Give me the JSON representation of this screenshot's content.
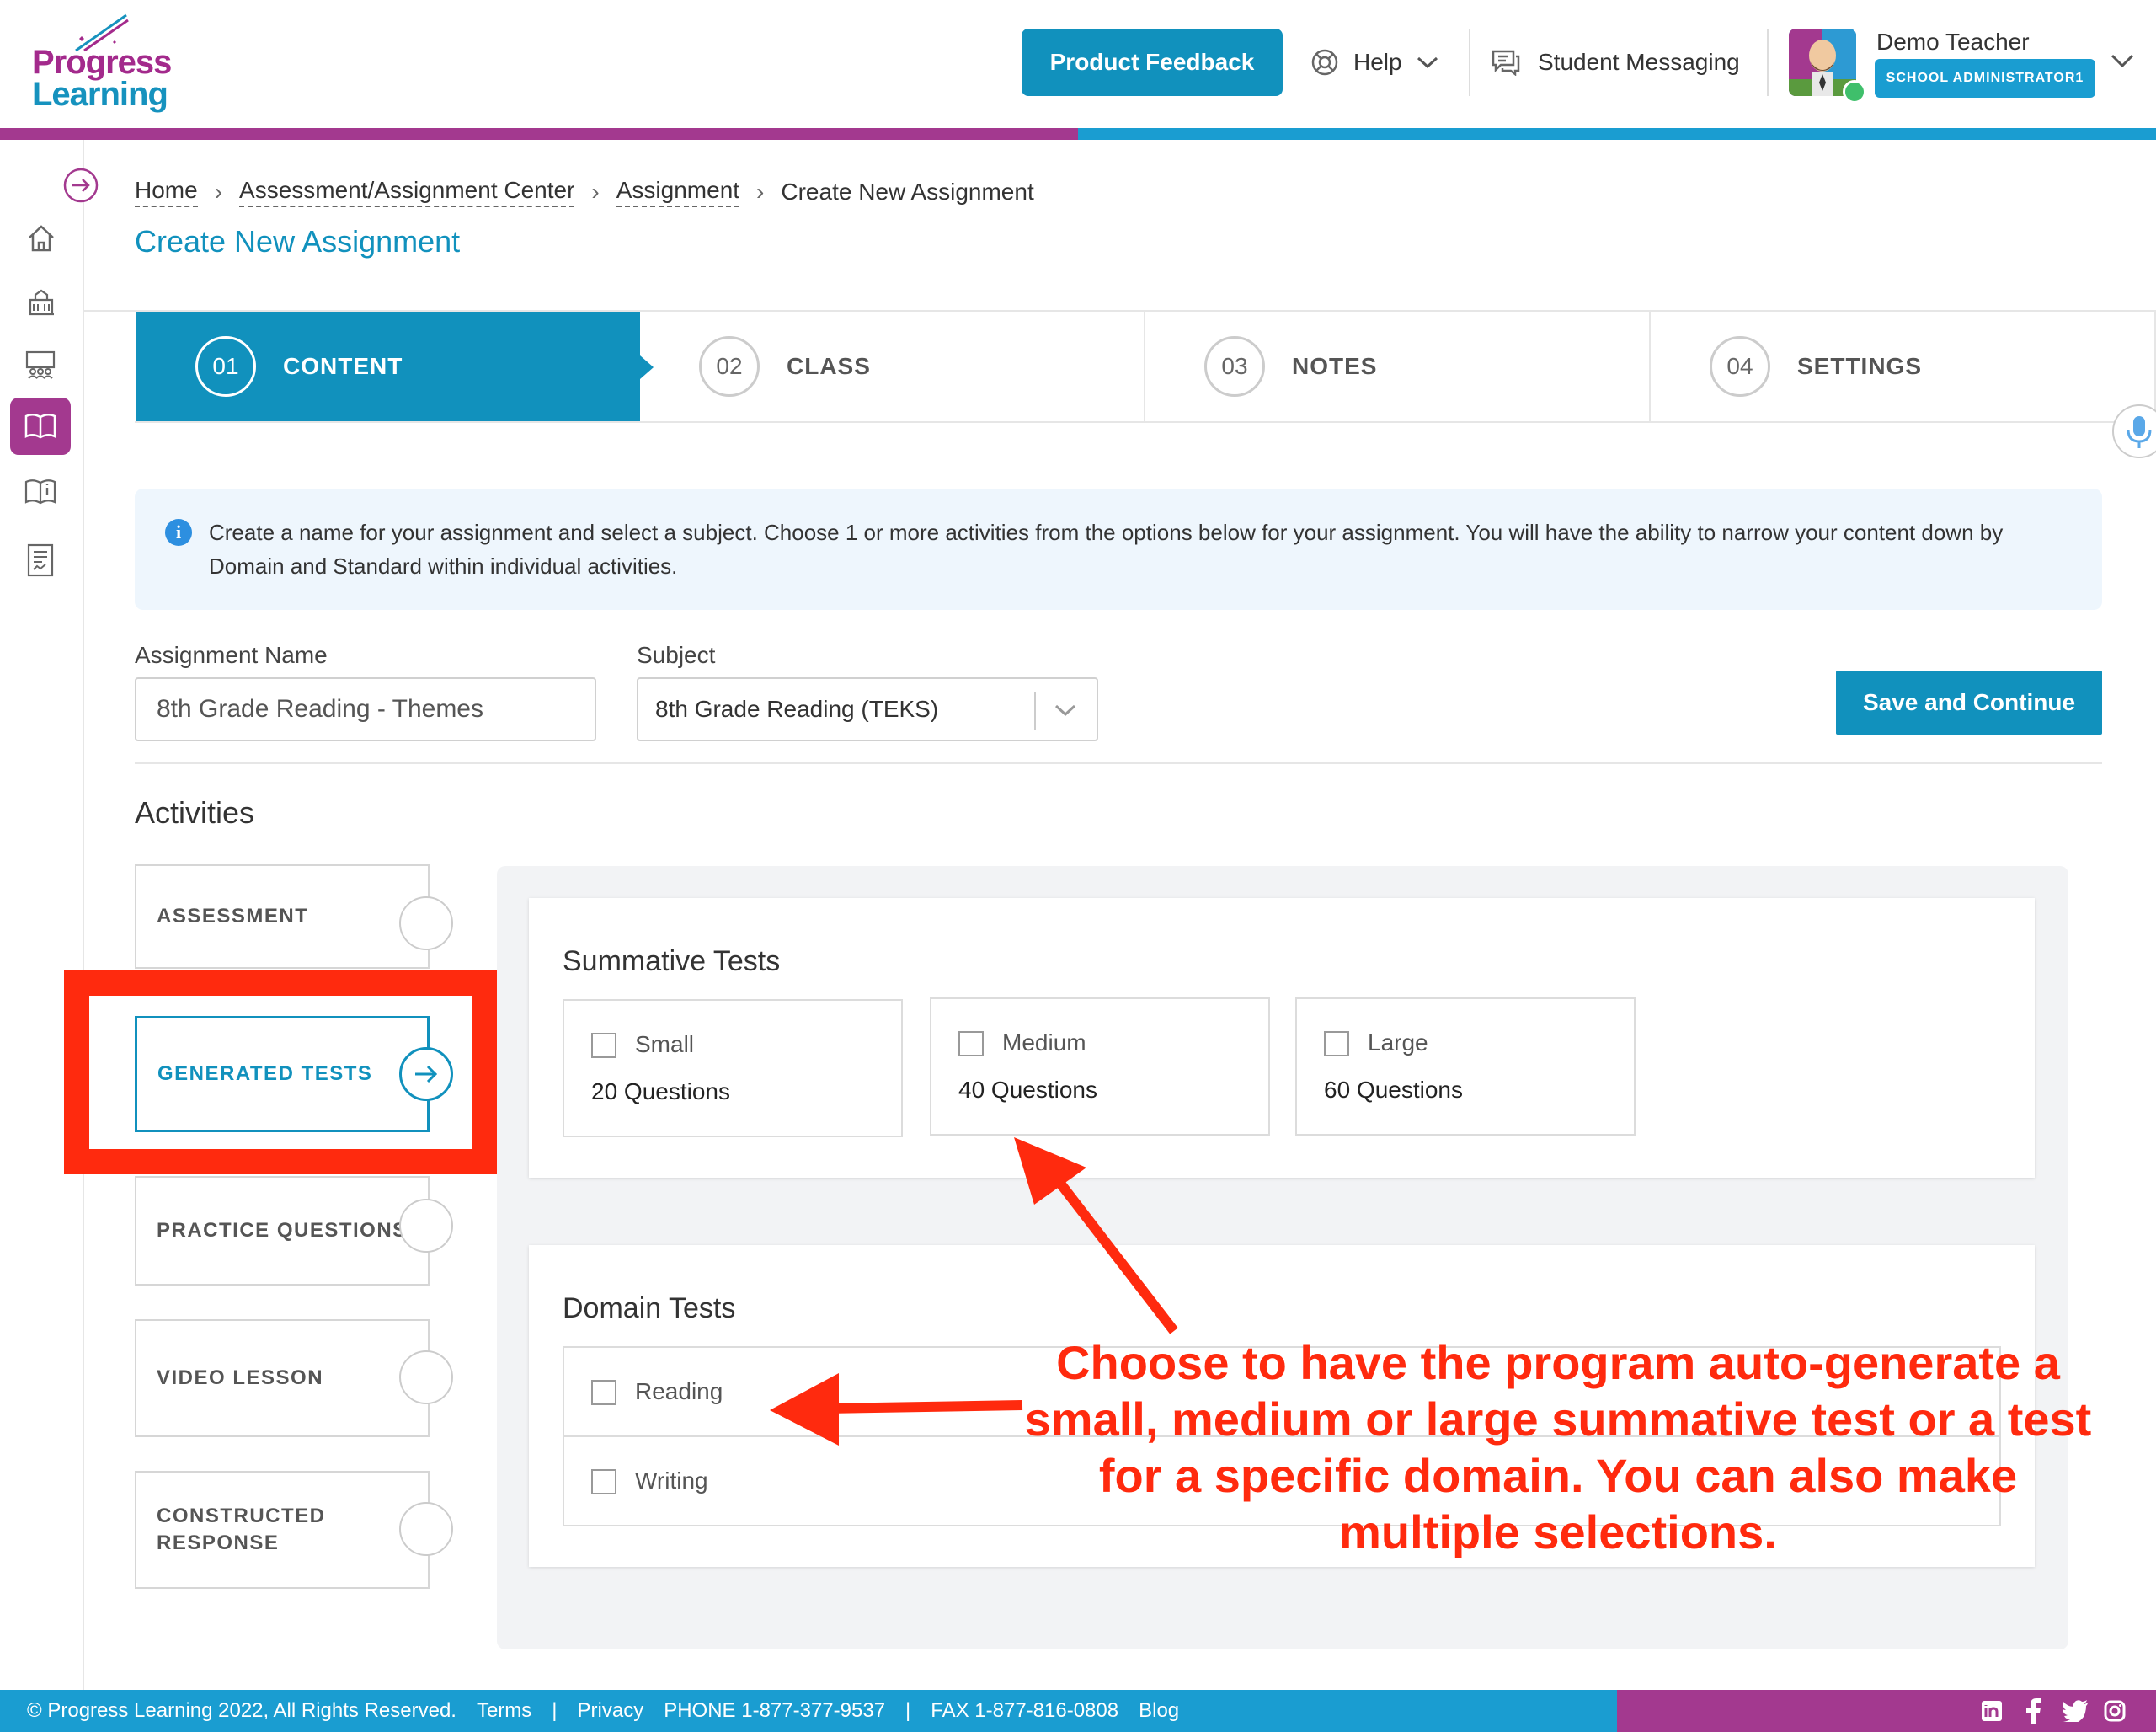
{
  "brand": {
    "logo_line1": "Progress",
    "logo_line2": "Learning",
    "purple": "#a3398f",
    "blue": "#1191bd"
  },
  "header": {
    "feedback_label": "Product Feedback",
    "help_label": "Help",
    "messaging_label": "Student Messaging",
    "user_name": "Demo Teacher",
    "user_role": "SCHOOL ADMINISTRATOR1"
  },
  "sidebar": {
    "items": [
      {
        "icon": "expand-arrow-icon"
      },
      {
        "icon": "home-icon"
      },
      {
        "icon": "school-icon"
      },
      {
        "icon": "classroom-icon"
      },
      {
        "icon": "book-icon",
        "active": true
      },
      {
        "icon": "book-info-icon"
      },
      {
        "icon": "report-icon"
      }
    ]
  },
  "breadcrumb": {
    "items": [
      "Home",
      "Assessment/Assignment Center",
      "Assignment",
      "Create New Assignment"
    ]
  },
  "page": {
    "title": "Create New Assignment"
  },
  "steps": [
    {
      "num": "01",
      "label": "CONTENT",
      "active": true
    },
    {
      "num": "02",
      "label": "CLASS"
    },
    {
      "num": "03",
      "label": "NOTES"
    },
    {
      "num": "04",
      "label": "SETTINGS"
    }
  ],
  "info": {
    "text": "Create a name for your assignment and select a subject. Choose 1 or more activities from the options below for your assignment. You will have the ability to narrow your content down by Domain and Standard within individual activities."
  },
  "form": {
    "name_label": "Assignment Name",
    "name_value": "8th Grade Reading - Themes",
    "subject_label": "Subject",
    "subject_value": "8th Grade Reading (TEKS)",
    "save_label": "Save and Continue"
  },
  "activities": {
    "title": "Activities",
    "tabs": [
      {
        "line1": "ASSESSMENT",
        "line2": ""
      },
      {
        "line1": "GENERATED TESTS",
        "line2": "",
        "selected": true
      },
      {
        "line1": "PRACTICE QUESTIONS",
        "line2": ""
      },
      {
        "line1": "VIDEO LESSON",
        "line2": ""
      },
      {
        "line1": "CONSTRUCTED",
        "line2": "RESPONSE"
      }
    ]
  },
  "summative": {
    "title": "Summative Tests",
    "options": [
      {
        "name": "Small",
        "questions": "20 Questions"
      },
      {
        "name": "Medium",
        "questions": "40 Questions"
      },
      {
        "name": "Large",
        "questions": "60 Questions"
      }
    ]
  },
  "domain": {
    "title": "Domain Tests",
    "options": [
      "Reading",
      "Writing"
    ]
  },
  "annotation": {
    "lines": [
      "Choose to have the program auto-generate a",
      "small, medium or large summative test or a test",
      "for a specific domain.  You can also make",
      "multiple selections."
    ],
    "color": "#ff2a0e"
  },
  "footer": {
    "copyright": "© Progress Learning 2022, All Rights Reserved.",
    "terms": "Terms",
    "sep1": "|",
    "privacy": "Privacy",
    "phone": "PHONE 1-877-377-9537",
    "sep2": "|",
    "fax": "FAX 1-877-816-0808",
    "blog": "Blog"
  }
}
